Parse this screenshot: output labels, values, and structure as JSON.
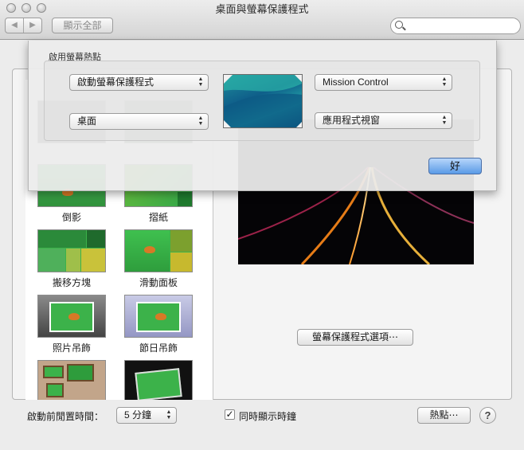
{
  "window": {
    "title": "桌面與螢幕保護程式"
  },
  "toolbar": {
    "back": "◀",
    "forward": "▶",
    "show_all": "顯示全部",
    "search_placeholder": ""
  },
  "sheet": {
    "heading": "啟用螢幕熱點",
    "top_left": "啟動螢幕保護程式",
    "bottom_left": "桌面",
    "top_right": "Mission Control",
    "bottom_right": "應用程式視窗",
    "ok": "好"
  },
  "savers": [
    {
      "label": "倒影"
    },
    {
      "label": "摺紙"
    },
    {
      "label": "搬移方塊"
    },
    {
      "label": "滑動面板"
    },
    {
      "label": "照片吊飾"
    },
    {
      "label": "節日吊飾"
    }
  ],
  "main": {
    "options_button": "螢幕保護程式選項⋯"
  },
  "bottom": {
    "idle_label": "啟動前閒置時間：",
    "idle_value": "5 分鐘",
    "show_clock_label": "同時顯示時鐘",
    "show_clock_checked": true,
    "check_mark": "✓",
    "hot_corners": "熱點⋯",
    "help": "?"
  },
  "colors": {
    "accent_button": "#5a9ae6",
    "green_theme": "#3cb24a"
  }
}
